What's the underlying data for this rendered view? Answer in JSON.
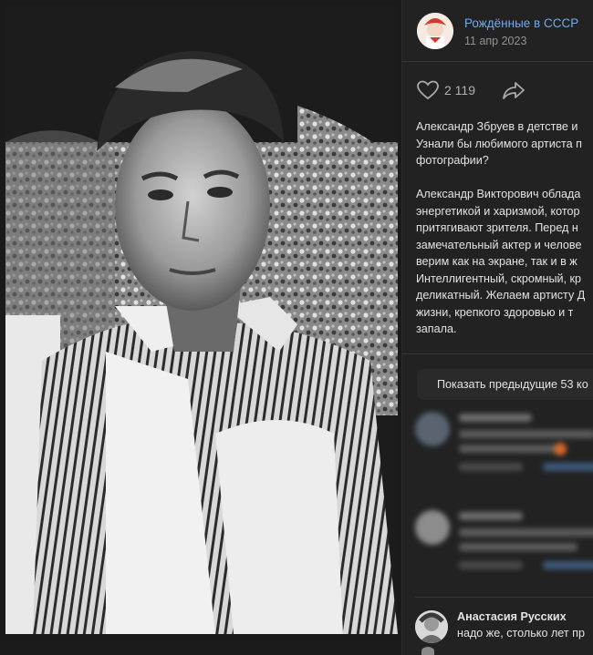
{
  "post": {
    "group_name": "Рождённые в СССР",
    "date": "11 апр 2023",
    "likes": "2 119",
    "icons": {
      "like": "heart-icon",
      "share": "share-arrow-icon"
    },
    "text_lines": [
      "Александр Збруев в детстве и",
      "Узнали бы любимого артиста п",
      "фотографии?",
      "",
      "Александр Викторович облада",
      "энергетикой и харизмой, котор",
      "притягивают зрителя. Перед н",
      "замечательный актер и челове",
      "верим как на экране, так и в ж",
      "Интеллигентный, скромный, кр",
      "деликатный. Желаем артисту Д",
      "жизни, крепкого здоровью и т",
      "запала."
    ]
  },
  "comments": {
    "show_previous": "Показать предыдущие 53 ко",
    "visible": [
      {
        "author": "Анастасия Русских",
        "text": "надо же, столько лет пр"
      }
    ]
  },
  "colors": {
    "background": "#1f1f1f",
    "panel": "#222222",
    "link": "#71aaeb",
    "muted": "#939393",
    "text": "#e1e3e6"
  }
}
